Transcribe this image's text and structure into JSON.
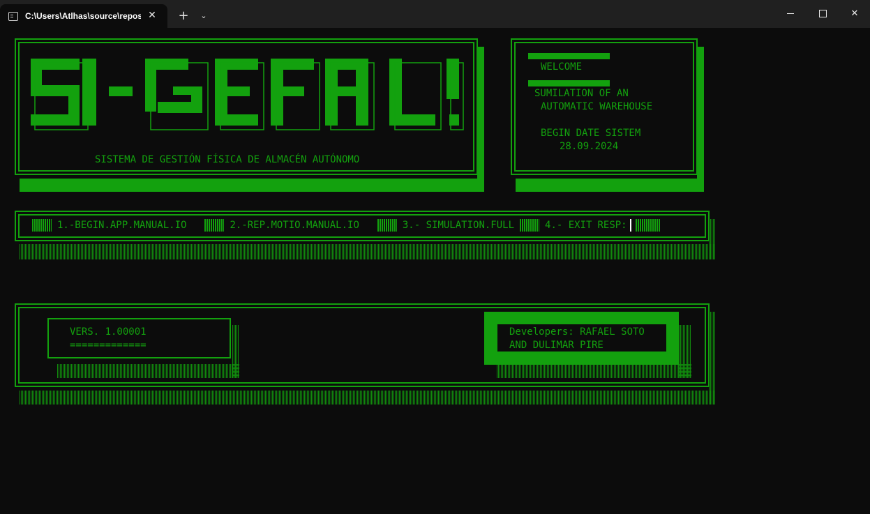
{
  "window": {
    "tab_title": "C:\\Users\\Atlhas\\source\\repos\\",
    "close_tab_glyph": "✕",
    "new_tab_glyph": "+",
    "tab_menu_glyph": "⌄",
    "close_glyph": "✕"
  },
  "banner": {
    "logo_text": "SI-GEFAL!",
    "subtitle": "SISTEMA DE GESTIÓN FÍSICA DE ALMACÉN AUTÓNOMO"
  },
  "welcome_box": {
    "heading": "WELCOME",
    "line1": "SUMILATION OF AN",
    "line2": "AUTOMATIC WAREHOUSE",
    "date_label": "BEGIN DATE SISTEM",
    "date_value": "28.09.2024"
  },
  "menu": {
    "items": [
      {
        "label": "1.-BEGIN.APP.MANUAL.IO"
      },
      {
        "label": "2.-REP.MOTIO.MANUAL.IO"
      },
      {
        "label": "3.- SIMULATION.FULL"
      },
      {
        "label": "4.- EXIT"
      }
    ],
    "prompt": "RESP:"
  },
  "footer": {
    "version_line": "VERS. 1.00001",
    "version_underline": "=============",
    "developers_line1": "Developers: RAFAEL SOTO",
    "developers_line2": "AND DULIMAR PIRE"
  },
  "colors": {
    "terminal_green": "#13a10e",
    "background": "#0c0c0c",
    "titlebar": "#202020"
  },
  "icons": {
    "tab_icon": "terminal-icon",
    "minimize": "minimize-icon",
    "maximize": "maximize-icon",
    "close": "close-icon"
  }
}
